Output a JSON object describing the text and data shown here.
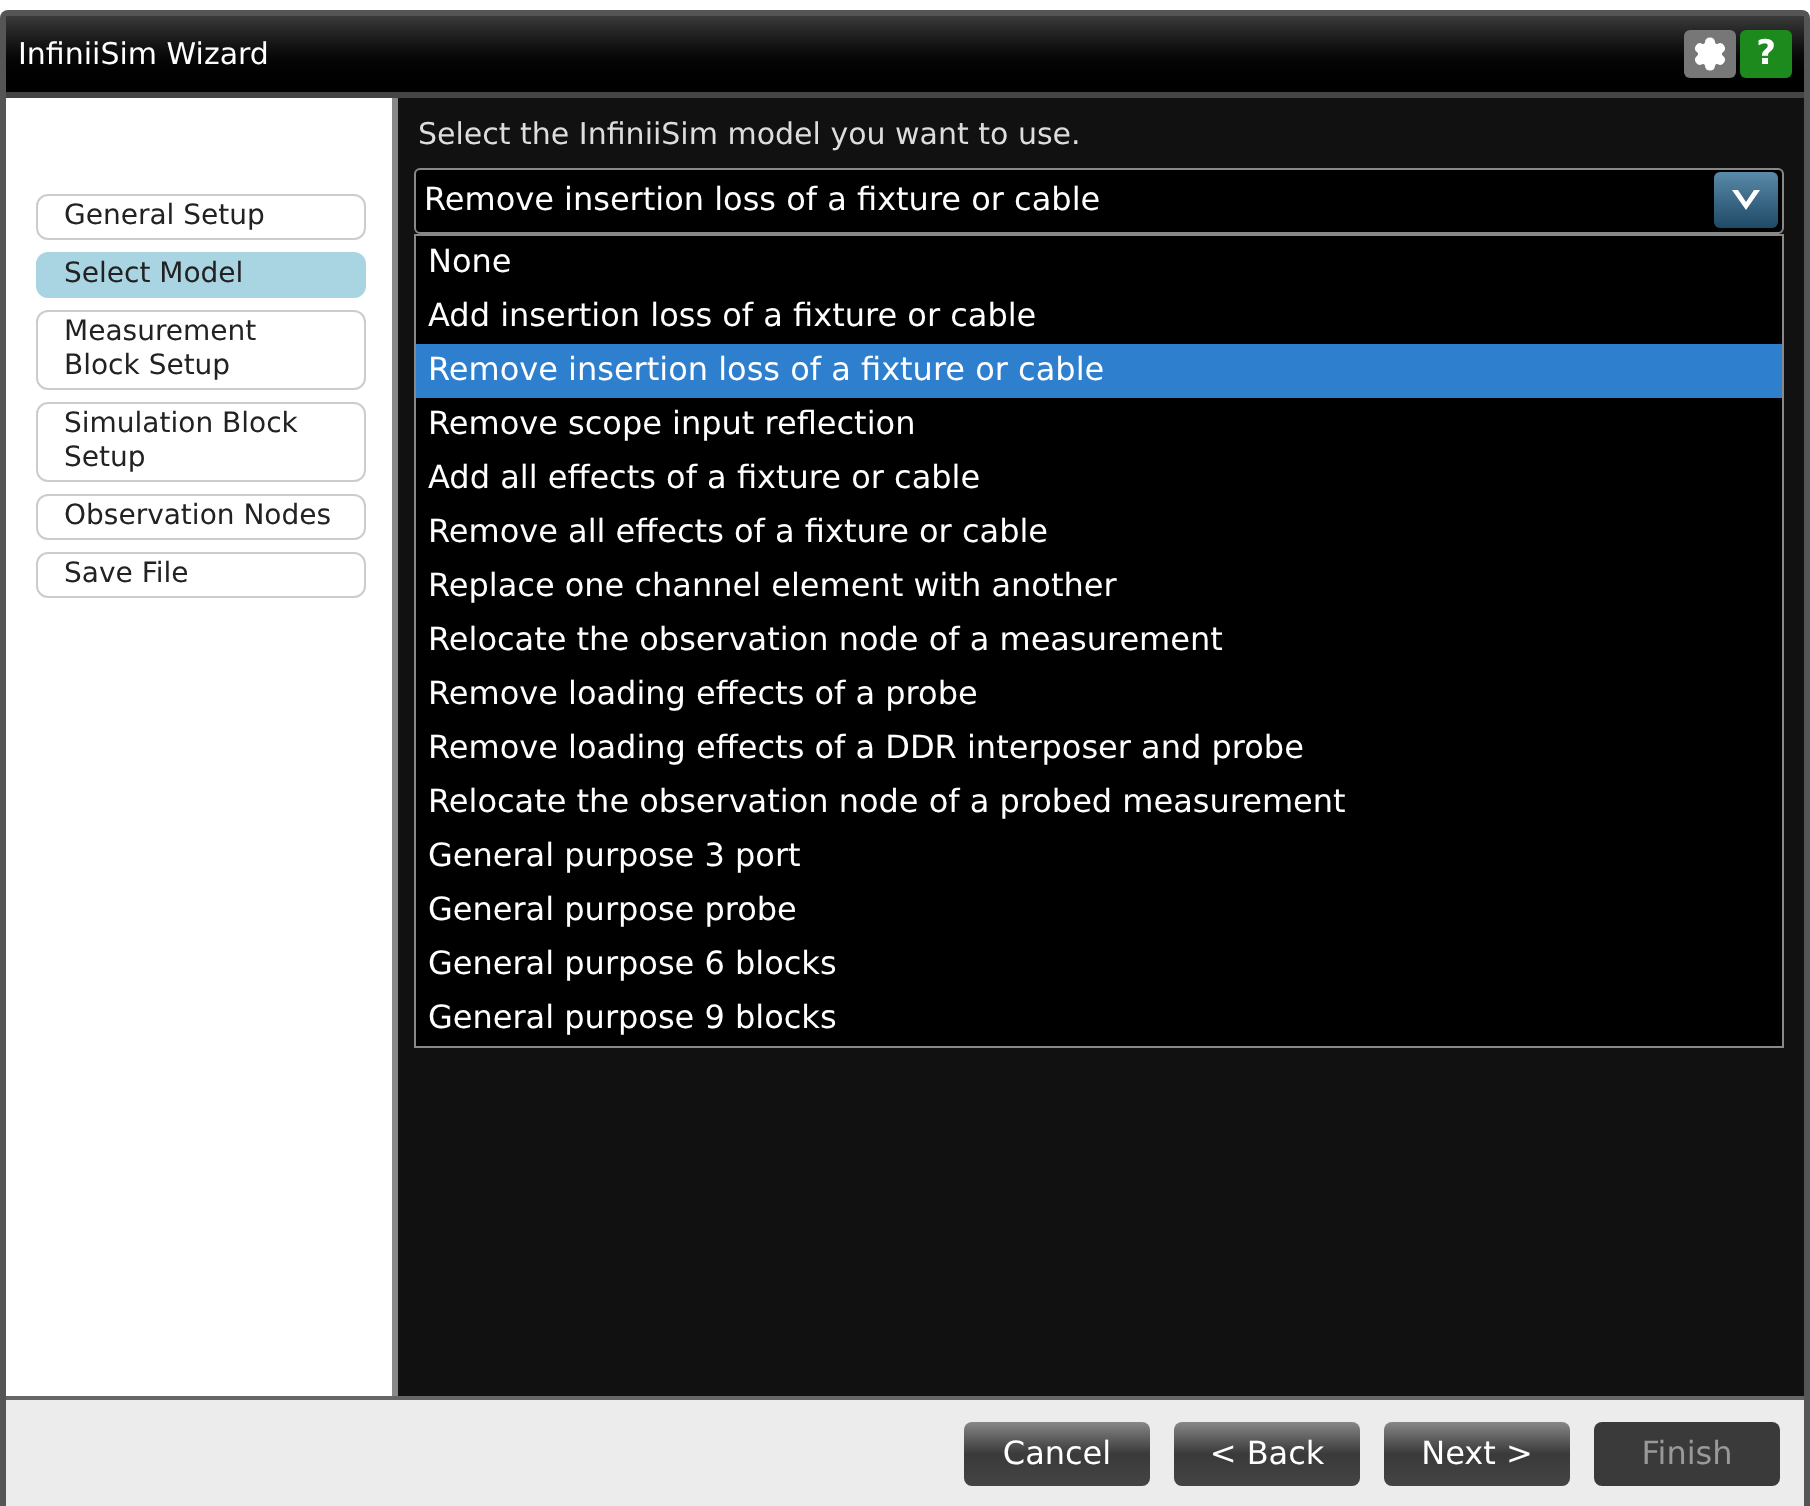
{
  "window": {
    "title": "InfiniiSim Wizard",
    "help": "?"
  },
  "steps": [
    {
      "label": "General Setup",
      "selected": false
    },
    {
      "label": "Select Model",
      "selected": true
    },
    {
      "label": "Measurement Block Setup",
      "selected": false
    },
    {
      "label": "Simulation Block Setup",
      "selected": false
    },
    {
      "label": "Observation Nodes",
      "selected": false
    },
    {
      "label": "Save File",
      "selected": false
    }
  ],
  "prompt": "Select the InfiniiSim model you want to use.",
  "model_dropdown": {
    "value": "Remove insertion loss of a fixture or cable",
    "expanded": true,
    "options": [
      {
        "label": "None",
        "selected": false
      },
      {
        "label": "Add insertion loss of a fixture or cable",
        "selected": false
      },
      {
        "label": "Remove insertion loss of a fixture or cable",
        "selected": true
      },
      {
        "label": "Remove scope input reflection",
        "selected": false
      },
      {
        "label": "Add all effects of a fixture or cable",
        "selected": false
      },
      {
        "label": "Remove all effects of a fixture or cable",
        "selected": false
      },
      {
        "label": "Replace one channel element with another",
        "selected": false
      },
      {
        "label": "Relocate the observation node of a measurement",
        "selected": false
      },
      {
        "label": "Remove loading effects of a probe",
        "selected": false
      },
      {
        "label": "Remove loading effects of a DDR interposer and probe",
        "selected": false
      },
      {
        "label": "Relocate the observation node of a probed measurement",
        "selected": false
      },
      {
        "label": "General purpose 3 port",
        "selected": false
      },
      {
        "label": "General purpose probe",
        "selected": false
      },
      {
        "label": "General purpose 6 blocks",
        "selected": false
      },
      {
        "label": "General purpose 9 blocks",
        "selected": false
      }
    ]
  },
  "buttons": [
    {
      "label": "Cancel",
      "disabled": false
    },
    {
      "label": "< Back",
      "disabled": false
    },
    {
      "label": "Next >",
      "disabled": false
    },
    {
      "label": "Finish",
      "disabled": true
    }
  ]
}
